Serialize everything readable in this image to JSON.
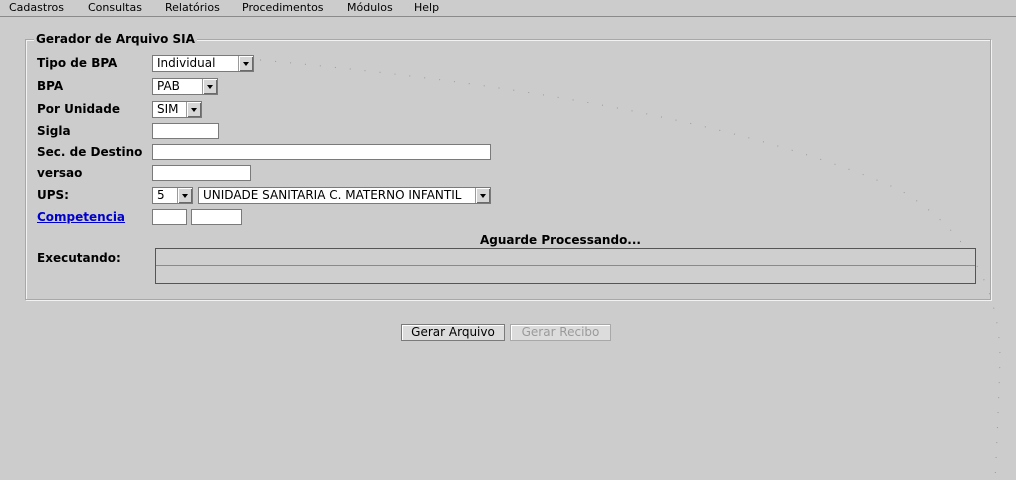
{
  "menu": {
    "items": [
      "Cadastros",
      "Consultas",
      "Relatórios",
      "Procedimentos",
      "Módulos",
      "Help"
    ]
  },
  "form": {
    "title": "Gerador de Arquivo SIA",
    "tipo_bpa": {
      "label": "Tipo de BPA",
      "value": "Individual"
    },
    "bpa": {
      "label": "BPA",
      "value": "PAB"
    },
    "por_unidade": {
      "label": "Por Unidade",
      "value": "SIM"
    },
    "sigla": {
      "label": "Sigla",
      "value": ""
    },
    "sec_destino": {
      "label": "Sec. de Destino",
      "value": ""
    },
    "versao": {
      "label": "versao",
      "value": ""
    },
    "ups": {
      "label": "UPS:",
      "code": "5",
      "unit": "UNIDADE SANITARIA C. MATERNO INFANTIL"
    },
    "competencia": {
      "label": "Competencia",
      "month": "",
      "year": ""
    },
    "status": "Aguarde Processando...",
    "executando_label": "Executando:"
  },
  "actions": {
    "gerar_arquivo": "Gerar Arquivo",
    "gerar_recibo": "Gerar Recibo"
  }
}
